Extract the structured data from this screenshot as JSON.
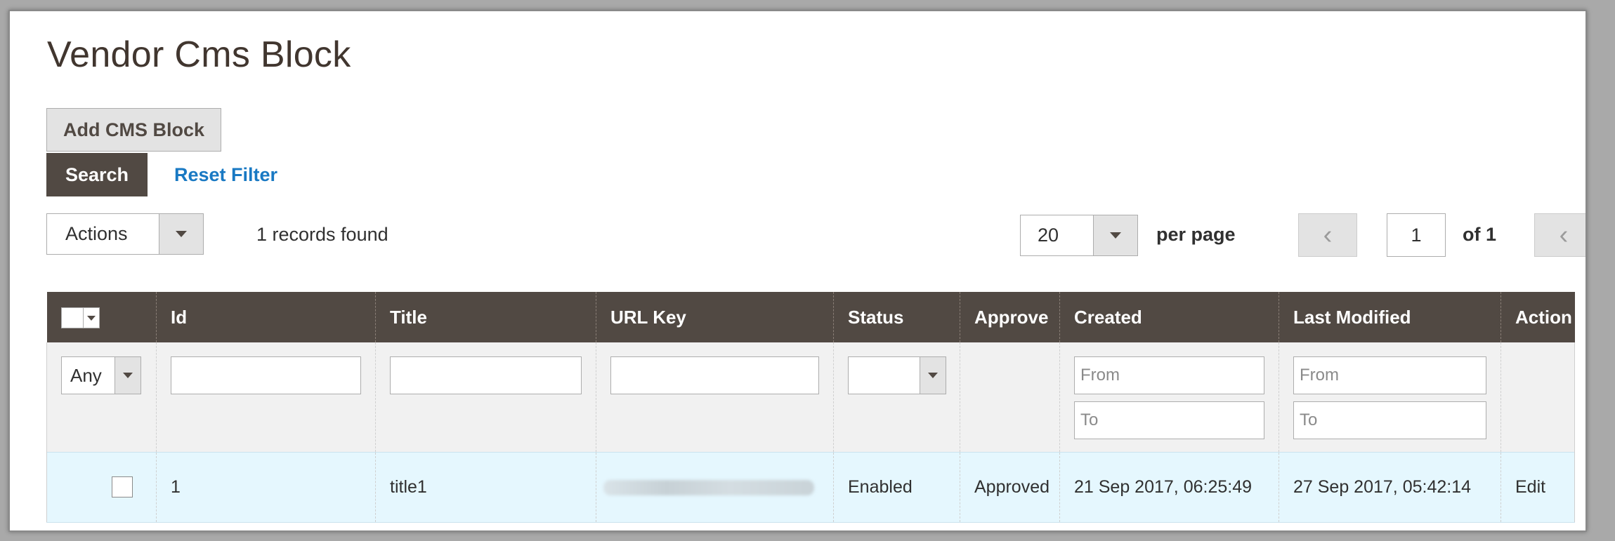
{
  "page": {
    "title": "Vendor Cms Block"
  },
  "toolbar": {
    "add_button": "Add CMS Block",
    "search_button": "Search",
    "reset_filter": "Reset Filter",
    "actions_label": "Actions",
    "records_found": "1 records found",
    "per_page_value": "20",
    "per_page_label": "per page",
    "page_number": "1",
    "of_pages": "of 1",
    "prev_icon": "‹",
    "next_icon": "‹"
  },
  "grid": {
    "columns": [
      "Id",
      "Title",
      "URL Key",
      "Status",
      "Approve",
      "Created",
      "Last Modified",
      "Action"
    ],
    "filters": {
      "any_label": "Any",
      "from_placeholder": "From",
      "to_placeholder": "To"
    },
    "rows": [
      {
        "id": "1",
        "title": "title1",
        "url_key": "",
        "status": "Enabled",
        "approve": "Approved",
        "created": "21 Sep 2017, 06:25:49",
        "last_modified": "27 Sep 2017, 05:42:14",
        "action": "Edit"
      }
    ]
  },
  "colors": {
    "header_bg": "#514943",
    "link_blue": "#1979c3",
    "approved_green": "#1a8a6e",
    "row_highlight": "#e5f7fe"
  }
}
